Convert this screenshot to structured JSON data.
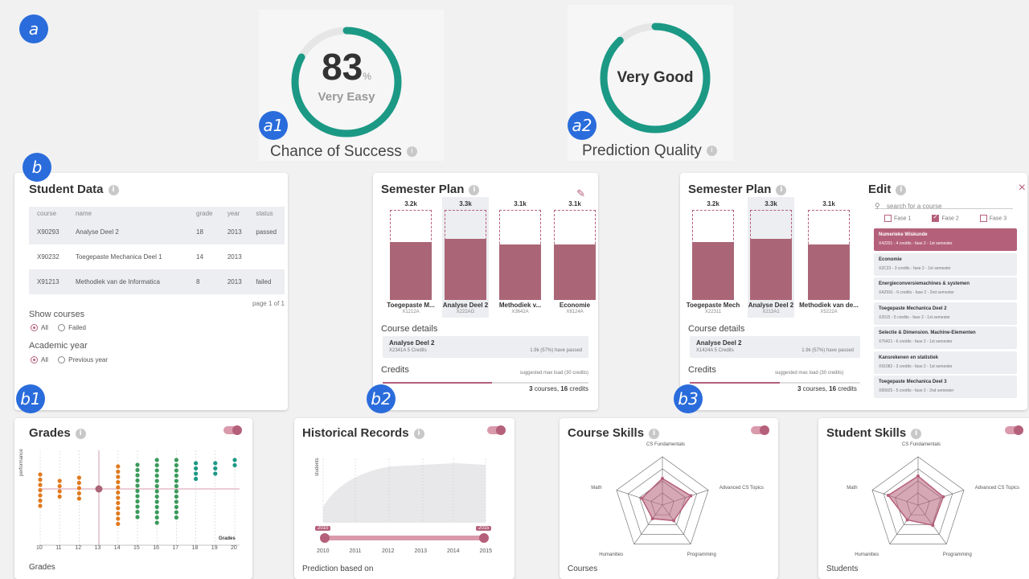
{
  "badges": {
    "a": "a",
    "a1": "a1",
    "a2": "a2",
    "b": "b",
    "b1": "b1",
    "b2": "b2",
    "b3": "b3"
  },
  "colors": {
    "accent": "#b5607a",
    "gauge": "#1b9985",
    "badge": "#2a6cdb"
  },
  "success_gauge": {
    "value": "83",
    "unit": "%",
    "label": "Very Easy",
    "fill": 0.83,
    "caption": "Chance of Success"
  },
  "quality_gauge": {
    "value": "Very Good",
    "fill": 0.88,
    "caption": "Prediction Quality"
  },
  "info_icon": "i",
  "student_data": {
    "title": "Student Data",
    "headers": [
      "course",
      "name",
      "grade",
      "year",
      "status"
    ],
    "rows": [
      [
        "X90293",
        "Analyse Deel 2",
        "18",
        "2013",
        "passed"
      ],
      [
        "X90232",
        "Toegepaste Mechanica Deel 1",
        "14",
        "2013",
        ""
      ],
      [
        "X91213",
        "Methodiek van de Informatica",
        "8",
        "2013",
        "failed"
      ]
    ],
    "pagination": "page 1 of 1",
    "show_courses_label": "Show courses",
    "show_options": [
      "All",
      "Failed"
    ],
    "year_label": "Academic year",
    "year_options": [
      "All",
      "Previous year"
    ]
  },
  "semester_plan_1": {
    "title": "Semester Plan",
    "edit_icon": "pencil-icon",
    "bars": [
      {
        "value": "3.2k",
        "name": "Toegepaste M...",
        "code": "X1212A",
        "fill": 0.64
      },
      {
        "value": "3.3k",
        "name": "Analyse Deel 2",
        "code": "X222AG",
        "fill": 0.68
      },
      {
        "value": "3.1k",
        "name": "Methodiek v...",
        "code": "X3642A",
        "fill": 0.62
      },
      {
        "value": "3.1k",
        "name": "Economie",
        "code": "X8124A",
        "fill": 0.62
      }
    ],
    "details_label": "Course details",
    "detail_name": "Analyse Deel 2",
    "detail_sub": "X2341A 5 Credits",
    "detail_right": "1.9k (57%) have passed",
    "credits_label": "Credits",
    "credits_note": "suggested max load (30 credits)",
    "credits_sum_a": "3",
    "credits_sum_b": " courses, ",
    "credits_sum_c": "16",
    "credits_sum_d": " credits",
    "credits_fill": 0.53
  },
  "semester_plan_2": {
    "title": "Semester Plan",
    "bars": [
      {
        "value": "3.2k",
        "name": "Toegepaste Mech",
        "code": "X22311",
        "fill": 0.64
      },
      {
        "value": "3.3k",
        "name": "Analyse Deel 2",
        "code": "X213A1",
        "fill": 0.68
      },
      {
        "value": "3.1k",
        "name": "Methodiek van de...",
        "code": "X5222A",
        "fill": 0.62
      }
    ],
    "details_label": "Course details",
    "detail_name": "Analyse Deel 2",
    "detail_sub": "X1424A 5 Credits",
    "detail_right": "1.9k (57%) have passed",
    "credits_label": "Credits",
    "credits_note": "suggested max load (30 credits)",
    "credits_sum_a": "3",
    "credits_sum_b": " courses, ",
    "credits_sum_c": "16",
    "credits_sum_d": " credits",
    "credits_fill": 0.53
  },
  "edit_panel": {
    "title": "Edit",
    "search_placeholder": "search for a course",
    "close": "×",
    "filters": [
      {
        "label": "Fase 1",
        "checked": false
      },
      {
        "label": "Fase 2",
        "checked": true
      },
      {
        "label": "Fase 3",
        "checked": false
      }
    ],
    "courses": [
      {
        "name": "Numerieke Wiskunde",
        "sub": "X42201 - 4 credits - fase 2 - 1st semester",
        "selected": true
      },
      {
        "name": "Economie",
        "sub": "X2C23 - 3 credits - fase 2 - 1st semester",
        "selected": false
      },
      {
        "name": "Energieconversiemachines & systemen",
        "sub": "XA2591 - 6 credits - fase 2 - 2nd semester",
        "selected": false
      },
      {
        "name": "Toegepaste Mechanica Deel 2",
        "sub": "X2015 - 5 credits - fase 2 - 1st semester",
        "selected": false
      },
      {
        "name": "Selectie & Dimension. Machine-Elementen",
        "sub": "X76421 - 6 credits - fase 2 - 1st semester",
        "selected": false
      },
      {
        "name": "Kansrekenen en statistiek",
        "sub": "X91082 - 3 credits - fase 2 - 1st semester",
        "selected": false
      },
      {
        "name": "Toegepaste Mechanica Deel 3",
        "sub": "X89925 - 5 credits - fase 2 - 2nd semester",
        "selected": false
      }
    ]
  },
  "grades": {
    "title": "Grades",
    "ylabel": "performance",
    "xlabel": "Grades",
    "ticks": [
      "10",
      "11",
      "12",
      "13",
      "14",
      "15",
      "16",
      "17",
      "18",
      "19",
      "20"
    ],
    "footer": "Grades"
  },
  "historical": {
    "title": "Historical Records",
    "ylabel": "students",
    "years": [
      "2010",
      "2011",
      "2012",
      "2013",
      "2014",
      "2015"
    ],
    "range_start": "2010",
    "range_end": "2015",
    "footer": "Prediction based on"
  },
  "course_skills": {
    "title": "Course Skills",
    "axes": [
      "CS Fundamentals",
      "Advanced CS Topics",
      "Programming",
      "Humanities",
      "Math"
    ],
    "values": [
      0.55,
      0.62,
      0.4,
      0.35,
      0.45
    ],
    "footer": "Courses"
  },
  "student_skills": {
    "title": "Student Skills",
    "axes": [
      "CS Fundamentals",
      "Advanced CS Topics",
      "Programming",
      "Humanities",
      "Math"
    ],
    "values": [
      0.6,
      0.55,
      0.52,
      0.38,
      0.65
    ],
    "footer": "Students"
  }
}
